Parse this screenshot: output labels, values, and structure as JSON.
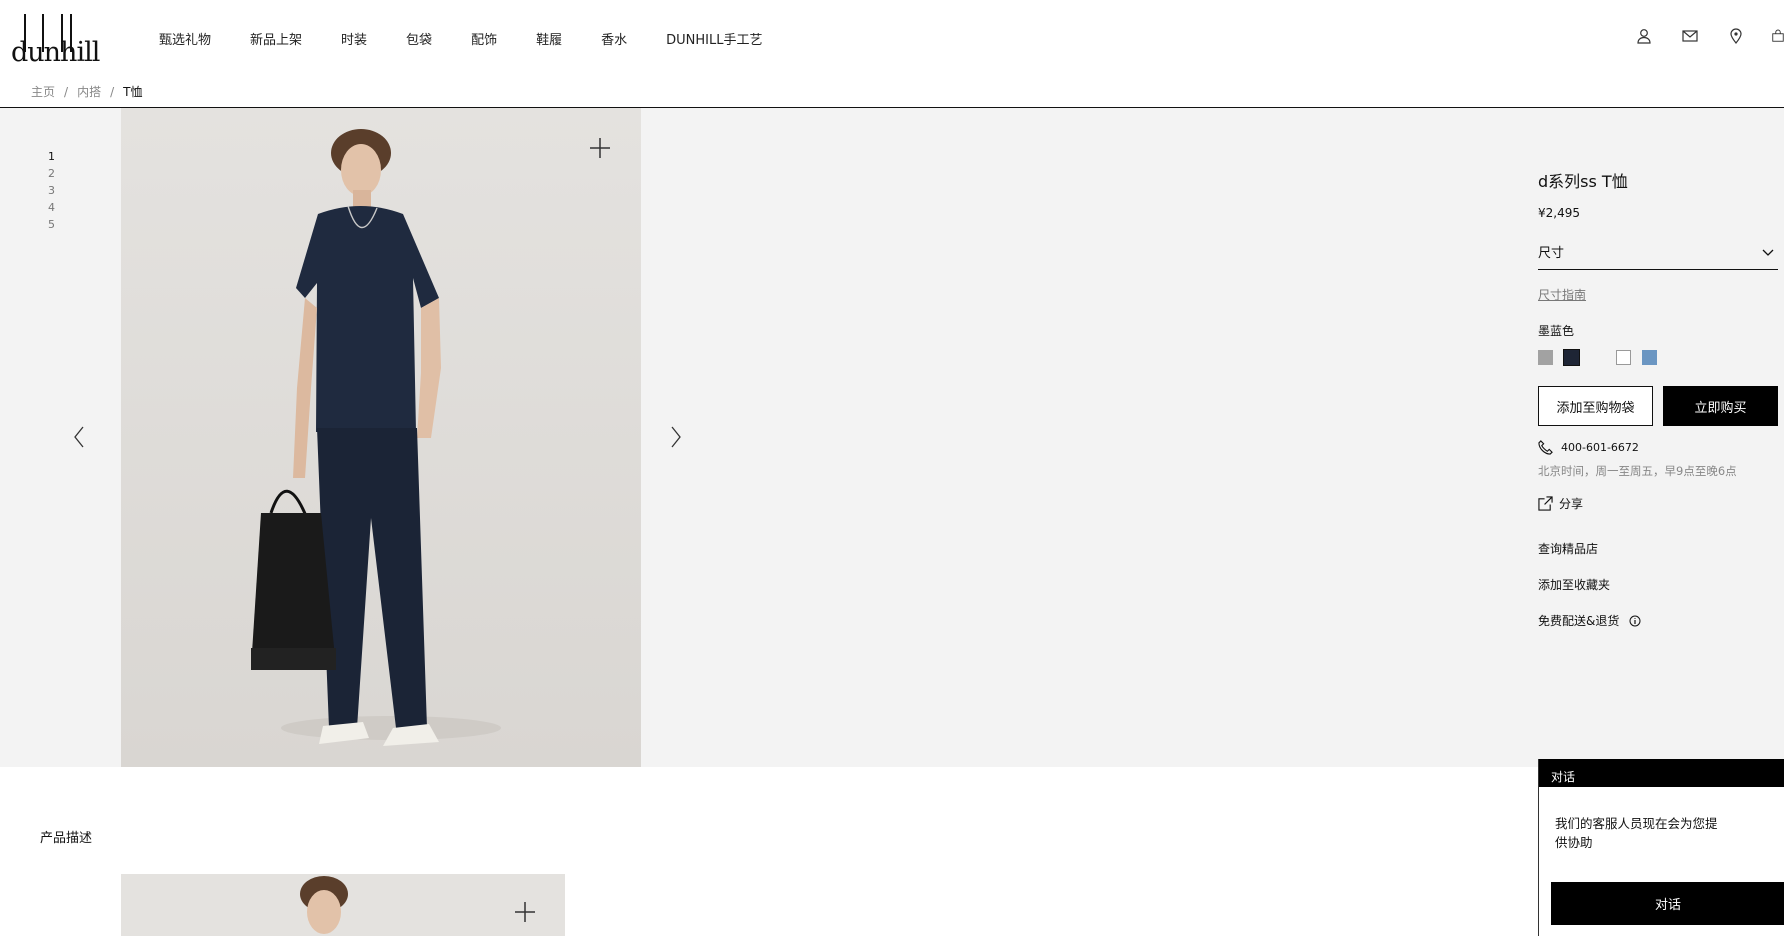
{
  "brand": {
    "name": "dunhill"
  },
  "nav": {
    "items": [
      "甄选礼物",
      "新品上架",
      "时装",
      "包袋",
      "配饰",
      "鞋履",
      "香水",
      "DUNHILL手工艺"
    ]
  },
  "breadcrumb": {
    "home": "主页",
    "category": "内搭",
    "current": "T恤",
    "separator": "/"
  },
  "gallery": {
    "indices": [
      "1",
      "2",
      "3",
      "4",
      "5"
    ],
    "active_index": 1
  },
  "product": {
    "title": "d系列ss T恤",
    "price": "¥2,495",
    "size_label": "尺寸",
    "size_guide": "尺寸指南",
    "color_name": "墨蓝色",
    "swatches": [
      {
        "color": "#a2a2a2",
        "selected": false
      },
      {
        "color": "#1e2535",
        "selected": true
      },
      {
        "color": "#f3f3f3",
        "selected": false
      },
      {
        "color": "#ffffff",
        "selected": false
      },
      {
        "color": "#6b96c2",
        "selected": false
      }
    ],
    "add_to_bag": "添加至购物袋",
    "buy_now": "立即购买",
    "phone": "400-601-6672",
    "hours": "北京时间，周一至周五，早9点至晚6点",
    "share": "分享",
    "find_store": "查询精品店",
    "add_wishlist": "添加至收藏夹",
    "free_shipping": "免费配送&退货"
  },
  "section": {
    "description_title": "产品描述"
  },
  "chat": {
    "header": "对话",
    "message": "我们的客服人员现在会为您提供协助",
    "button": "对话"
  },
  "colors": {
    "accent": "#000000",
    "stage_bg": "#f3f3f3",
    "muted_text": "#888888"
  }
}
